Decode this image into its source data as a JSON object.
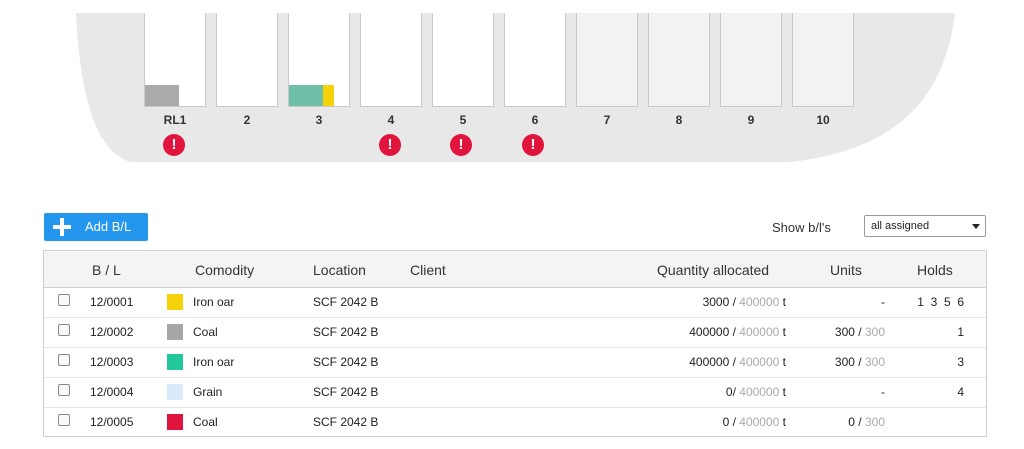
{
  "ship": {
    "hull_color": "#e8e8e8",
    "holds": [
      {
        "label": "RL1",
        "alert": true,
        "fills": [
          {
            "color": "#aaaaaa",
            "fraction": 0.57
          }
        ]
      },
      {
        "label": "2",
        "alert": false,
        "fills": []
      },
      {
        "label": "3",
        "alert": false,
        "fills": [
          {
            "color": "#6dbfa7",
            "fraction": 0.57
          },
          {
            "color": "#f5d20a",
            "fraction": 0.19
          }
        ]
      },
      {
        "label": "4",
        "alert": true,
        "fills": []
      },
      {
        "label": "5",
        "alert": true,
        "fills": []
      },
      {
        "label": "6",
        "alert": true,
        "fills": []
      },
      {
        "label": "7",
        "alert": false,
        "fills": []
      },
      {
        "label": "8",
        "alert": false,
        "fills": []
      },
      {
        "label": "9",
        "alert": false,
        "fills": []
      },
      {
        "label": "10",
        "alert": false,
        "fills": []
      }
    ],
    "alert_symbol": "!"
  },
  "toolbar": {
    "add_label": "Add B/L",
    "add_icon": "plus-icon",
    "show_label": "Show b/l's",
    "show_select_value": "all assigned",
    "accent": "#2396ee"
  },
  "table": {
    "headers": {
      "bl": "B / L",
      "commodity": "Comodity",
      "location": "Location",
      "client": "Client",
      "quantity": "Quantity allocated",
      "units": "Units",
      "holds": "Holds"
    },
    "rows": [
      {
        "bl": "12/0001",
        "color": "#f5d20a",
        "commodity": "Iron oar",
        "location": "SCF 2042 B",
        "client": "",
        "qty": "3000",
        "qty_sep": " / ",
        "qty_total": "400000",
        "qty_unit": "t",
        "units": "-",
        "units_sep": "",
        "units_total": "",
        "holds": "1  3  5  6"
      },
      {
        "bl": "12/0002",
        "color": "#a6a6a6",
        "commodity": "Coal",
        "location": "SCF 2042 B",
        "client": "",
        "qty": "400000",
        "qty_sep": " / ",
        "qty_total": "400000",
        "qty_unit": "t",
        "units": "300",
        "units_sep": " / ",
        "units_total": "300",
        "holds": "1"
      },
      {
        "bl": "12/0003",
        "color": "#22c79a",
        "commodity": "Iron oar",
        "location": "SCF 2042 B",
        "client": "",
        "qty": "400000",
        "qty_sep": " / ",
        "qty_total": "400000",
        "qty_unit": "t",
        "units": "300",
        "units_sep": " / ",
        "units_total": "300",
        "holds": "3"
      },
      {
        "bl": "12/0004",
        "color": "#dbeafb",
        "commodity": "Grain",
        "location": "SCF 2042 B",
        "client": "",
        "qty": "0",
        "qty_sep": "/ ",
        "qty_total": "400000",
        "qty_unit": "t",
        "units": "-",
        "units_sep": "",
        "units_total": "",
        "holds": "4"
      },
      {
        "bl": "12/0005",
        "color": "#e0143c",
        "commodity": "Coal",
        "location": "SCF 2042 B",
        "client": "",
        "qty": "0",
        "qty_sep": " / ",
        "qty_total": "400000",
        "qty_unit": "t",
        "units": "0",
        "units_sep": " / ",
        "units_total": "300",
        "holds": ""
      }
    ]
  }
}
